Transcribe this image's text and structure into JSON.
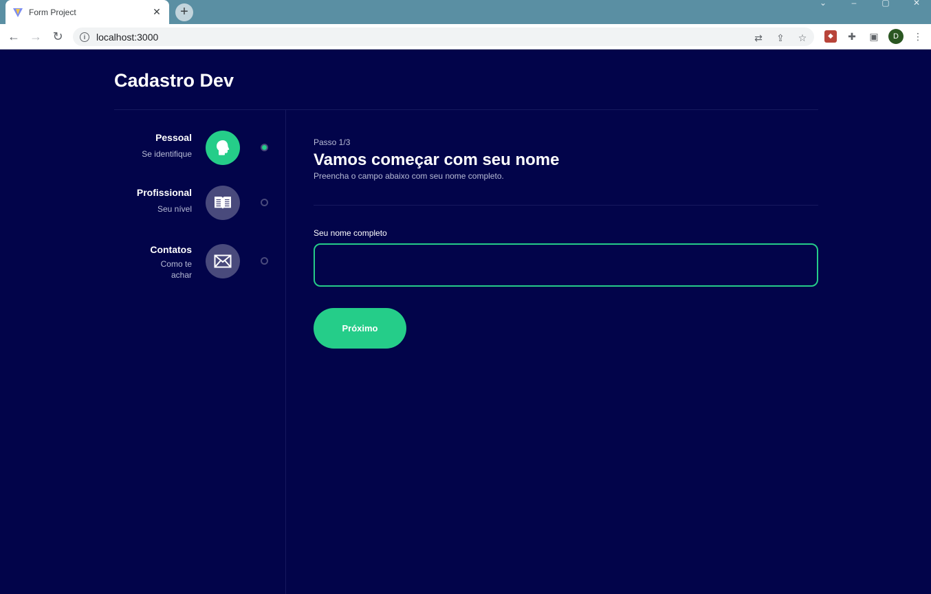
{
  "browser": {
    "tab_title": "Form Project",
    "tab_close": "✕",
    "new_tab": "+",
    "url": "localhost:3000",
    "profile_initial": "D"
  },
  "app": {
    "brand_title": "Cadastro Dev"
  },
  "steps": [
    {
      "title": "Pessoal",
      "description": "Se identifique",
      "icon": "person-icon",
      "active": true
    },
    {
      "title": "Profissional",
      "description": "Seu nível",
      "icon": "book-icon",
      "active": false
    },
    {
      "title": "Contatos",
      "description": "Como te achar",
      "icon": "mail-icon",
      "active": false
    }
  ],
  "form": {
    "step_counter": "Passo 1/3",
    "title": "Vamos começar com seu nome",
    "subtitle": "Preencha o campo abaixo com seu nome completo.",
    "field_label": "Seu nome completo",
    "field_value": "",
    "next_label": "Próximo"
  },
  "colors": {
    "background": "#02044a",
    "accent": "#25cd89",
    "inactive": "#494a7c"
  }
}
